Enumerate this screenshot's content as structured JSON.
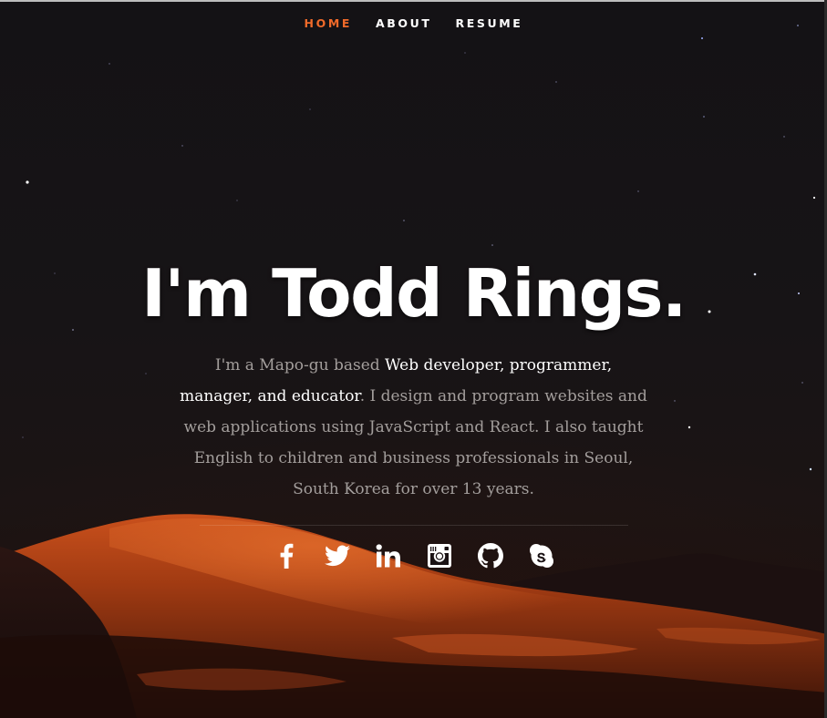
{
  "nav": {
    "items": [
      {
        "label": "HOME",
        "active": true
      },
      {
        "label": "ABOUT",
        "active": false
      },
      {
        "label": "RESUME",
        "active": false
      }
    ]
  },
  "hero": {
    "title": "I'm Todd Rings.",
    "bio": {
      "intro": "I'm a Mapo-gu based ",
      "highlight": "Web developer, programmer, manager, and educator",
      "rest": ". I design and program websites and web applications using JavaScript and React. I also taught English to children and business professionals in Seoul, South Korea for over 13 years."
    }
  },
  "social": {
    "icons": [
      "facebook-icon",
      "twitter-icon",
      "linkedin-icon",
      "instagram-icon",
      "github-icon",
      "skype-icon"
    ]
  },
  "colors": {
    "accent": "#f06a2a",
    "text": "#ffffff",
    "muted": "#a39e9c",
    "background": "#141214"
  }
}
